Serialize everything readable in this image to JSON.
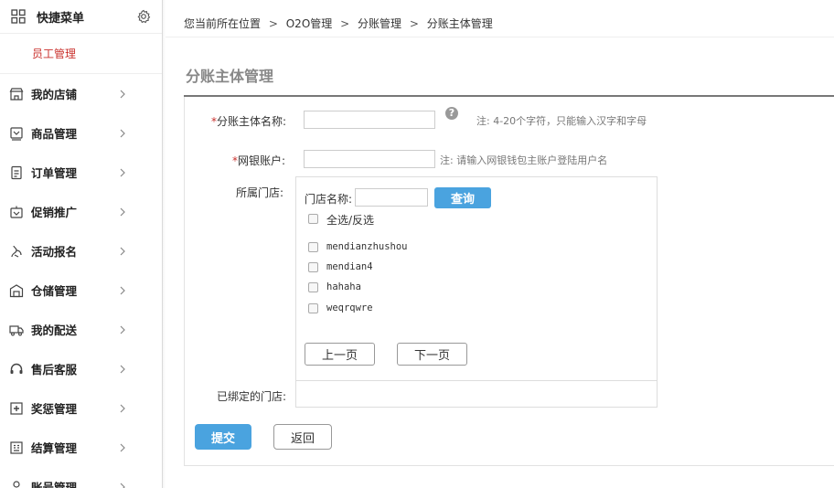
{
  "sidebar": {
    "quick_menu_title": "快捷菜单",
    "quick_menu_item": "员工管理",
    "items": [
      {
        "label": "我的店铺",
        "icon": "store-icon"
      },
      {
        "label": "商品管理",
        "icon": "product-icon"
      },
      {
        "label": "订单管理",
        "icon": "order-icon"
      },
      {
        "label": "促销推广",
        "icon": "promotion-icon"
      },
      {
        "label": "活动报名",
        "icon": "activity-icon"
      },
      {
        "label": "仓储管理",
        "icon": "warehouse-icon"
      },
      {
        "label": "我的配送",
        "icon": "delivery-icon"
      },
      {
        "label": "售后客服",
        "icon": "headset-icon"
      },
      {
        "label": "奖惩管理",
        "icon": "reward-icon"
      },
      {
        "label": "结算管理",
        "icon": "settlement-icon"
      },
      {
        "label": "账号管理",
        "icon": "account-icon"
      }
    ]
  },
  "breadcrumb": {
    "prefix": "您当前所在位置",
    "items": [
      "O2O管理",
      "分账管理",
      "分账主体管理"
    ],
    "separator": ">"
  },
  "page_title": "分账主体管理",
  "form": {
    "name_label": "分账主体名称:",
    "name_value": "",
    "name_hint": "注: 4-20个字符，只能输入汉字和字母",
    "bank_label": "网银账户:",
    "bank_value": "",
    "bank_hint": "注: 请输入网银钱包主账户登陆用户名",
    "store_label": "所属门店:",
    "store_name_label": "门店名称:",
    "store_name_value": "",
    "query_button": "查询",
    "select_all_label": "全选/反选",
    "stores": [
      "mendianzhushou",
      "mendian4",
      "hahaha",
      "weqrqwre"
    ],
    "prev_page": "上一页",
    "next_page": "下一页",
    "bound_label": "已绑定的门店:",
    "submit_button": "提交",
    "back_button": "返回"
  },
  "colors": {
    "accent": "#4aa3df",
    "required": "#c9302c",
    "quick_item": "#c9302c"
  }
}
